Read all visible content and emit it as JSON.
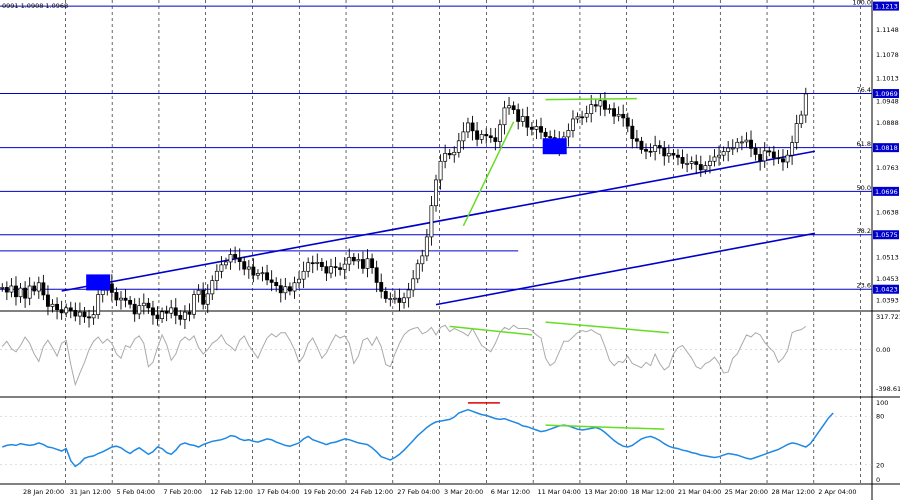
{
  "chart_data": {
    "type": "candlestick",
    "header_text": "0991 1.0908 1.0968",
    "price_axis": {
      "ylim": [
        1.0365,
        1.123
      ],
      "ticks": [
        1.1148,
        1.1078,
        1.1013,
        1.0948,
        1.0888,
        1.0763,
        1.0638,
        1.0513,
        1.0453,
        1.0393
      ],
      "current_price": 1.0969
    },
    "time_labels": [
      "28 Jan 20:00",
      "31 Jan 12:00",
      "5 Feb 04:00",
      "7 Feb 20:00",
      "12 Feb 12:00",
      "17 Feb 04:00",
      "19 Feb 20:00",
      "24 Feb 12:00",
      "27 Feb 04:00",
      "3 Mar 20:00",
      "6 Mar 12:00",
      "11 Mar 04:00",
      "13 Mar 20:00",
      "18 Mar 12:00",
      "21 Mar 04:00",
      "25 Mar 20:00",
      "28 Mar 12:00",
      "2 Apr 04:00"
    ],
    "fib_levels": [
      {
        "label": "100.0",
        "price": 1.1213
      },
      {
        "label": "76.4",
        "price": 1.0969
      },
      {
        "label": "61.8",
        "price": 1.0818
      },
      {
        "label": "50.0",
        "price": 1.0696
      },
      {
        "label": "38.2",
        "price": 1.0575
      },
      {
        "label": "23.6",
        "price": 1.0423
      }
    ],
    "support_line_price": 1.053,
    "trendlines": [
      {
        "name": "upper",
        "start": {
          "bar": 13,
          "price": 1.0418
        },
        "end": {
          "bar": 178,
          "price": 1.0808
        }
      },
      {
        "name": "lower",
        "start": {
          "bar": 95,
          "price": 1.038
        },
        "end": {
          "bar": 178,
          "price": 1.0579
        }
      }
    ],
    "close_series": [
      1.0428,
      1.0415,
      1.0432,
      1.0402,
      1.0426,
      1.0398,
      1.0432,
      1.0418,
      1.0441,
      1.0407,
      1.0375,
      1.0381,
      1.0366,
      1.0357,
      1.0371,
      1.0364,
      1.0348,
      1.0359,
      1.0346,
      1.0343,
      1.0352,
      1.0408,
      1.042,
      1.0438,
      1.0414,
      1.0393,
      1.0398,
      1.0392,
      1.0381,
      1.0354,
      1.0377,
      1.0384,
      1.0371,
      1.0351,
      1.0341,
      1.036,
      1.0356,
      1.0371,
      1.035,
      1.0339,
      1.0359,
      1.0353,
      1.0408,
      1.042,
      1.0381,
      1.041,
      1.0447,
      1.0473,
      1.0491,
      1.0499,
      1.052,
      1.051,
      1.05,
      1.0479,
      1.0485,
      1.0462,
      1.0467,
      1.0469,
      1.0449,
      1.0442,
      1.0433,
      1.0413,
      1.043,
      1.0418,
      1.0441,
      1.0451,
      1.0473,
      1.0497,
      1.0495,
      1.0498,
      1.0486,
      1.0468,
      1.0486,
      1.0483,
      1.0478,
      1.0493,
      1.0512,
      1.0502,
      1.0506,
      1.0481,
      1.0508,
      1.0483,
      1.0442,
      1.0417,
      1.0397,
      1.0397,
      1.0398,
      1.0386,
      1.0399,
      1.0421,
      1.0452,
      1.0494,
      1.0516,
      1.0569,
      1.0656,
      1.0728,
      1.078,
      1.0802,
      1.0798,
      1.0805,
      1.0837,
      1.0862,
      1.0887,
      1.0865,
      1.0841,
      1.0855,
      1.0851,
      1.0846,
      1.0835,
      1.0882,
      1.0929,
      1.0935,
      1.0924,
      1.0891,
      1.0905,
      1.0875,
      1.0869,
      1.0877,
      1.0861,
      1.0849,
      1.0846,
      1.0819,
      1.0837,
      1.0848,
      1.0866,
      1.0898,
      1.0904,
      1.0903,
      1.0913,
      1.0938,
      1.0934,
      1.0949,
      1.0925,
      1.0927,
      1.0906,
      1.0911,
      1.0901,
      1.0878,
      1.0843,
      1.0836,
      1.0813,
      1.0808,
      1.0807,
      1.0824,
      1.0817,
      1.0795,
      1.0802,
      1.0797,
      1.0791,
      1.0774,
      1.0774,
      1.0779,
      1.0771,
      1.0756,
      1.0768,
      1.078,
      1.0792,
      1.0797,
      1.0807,
      1.0817,
      1.0817,
      1.0833,
      1.0834,
      1.0839,
      1.0816,
      1.0799,
      1.0781,
      1.0809,
      1.0806,
      1.079,
      1.0787,
      1.0778,
      1.0797,
      1.0832,
      1.0885,
      1.0909,
      1.0968
    ],
    "markers": [
      {
        "bar": 21,
        "price": 1.0442
      },
      {
        "bar": 121,
        "price": 1.0822
      }
    ],
    "indicator1": {
      "label_max": "317.7217",
      "label_mid": "0.00",
      "label_min": "-398.612",
      "ylim": [
        -398.612,
        317.7217
      ],
      "values": [
        30,
        80,
        10,
        -20,
        40,
        120,
        60,
        -40,
        -110,
        30,
        90,
        20,
        -60,
        60,
        90,
        -140,
        -330,
        -220,
        -120,
        0,
        80,
        120,
        60,
        100,
        60,
        -40,
        -80,
        40,
        20,
        100,
        130,
        60,
        -160,
        -120,
        20,
        140,
        50,
        -100,
        -40,
        80,
        120,
        90,
        130,
        20,
        -40,
        0,
        60,
        90,
        140,
        60,
        30,
        -10,
        90,
        130,
        40,
        -20,
        -80,
        20,
        110,
        150,
        120,
        160,
        160,
        90,
        0,
        -120,
        -60,
        60,
        110,
        20,
        -80,
        -30,
        60,
        140,
        110,
        130,
        60,
        -130,
        -60,
        90,
        110,
        40,
        120,
        30,
        -140,
        -160,
        -40,
        60,
        140,
        180,
        200,
        210,
        150,
        170,
        210,
        140,
        210,
        230,
        170,
        200,
        180,
        160,
        130,
        200,
        120,
        40,
        10,
        -20,
        60,
        160,
        210,
        190,
        230,
        200,
        200,
        200,
        180,
        140,
        110,
        -80,
        -150,
        -120,
        -20,
        80,
        80,
        120,
        160,
        180,
        170,
        190,
        160,
        140,
        30,
        -100,
        -150,
        -110,
        -120,
        -60,
        -130,
        -150,
        -170,
        -120,
        -150,
        -40,
        -130,
        -190,
        -160,
        -40,
        20,
        40,
        -20,
        -80,
        -160,
        -180,
        -130,
        -110,
        -70,
        -130,
        -220,
        -210,
        -80,
        -40,
        50,
        140,
        120,
        160,
        140,
        70,
        20,
        -20,
        -120,
        -80,
        -10,
        160,
        180,
        190,
        220
      ]
    },
    "indicator2": {
      "label_max": "100",
      "label_80": "80",
      "label_20": "20",
      "label_0": "0",
      "ylim": [
        0,
        100
      ],
      "values": [
        42,
        44,
        45,
        44,
        46,
        45,
        44,
        45,
        47,
        45,
        42,
        41,
        39,
        37,
        40,
        25,
        18,
        22,
        28,
        30,
        31,
        34,
        36,
        39,
        42,
        43,
        41,
        37,
        34,
        38,
        41,
        37,
        33,
        36,
        42,
        40,
        35,
        33,
        38,
        45,
        47,
        45,
        44,
        42,
        45,
        47,
        49,
        50,
        51,
        53,
        56,
        55,
        52,
        50,
        51,
        49,
        48,
        50,
        52,
        51,
        48,
        46,
        44,
        43,
        45,
        47,
        52,
        55,
        51,
        49,
        47,
        45,
        47,
        48,
        50,
        52,
        51,
        49,
        47,
        46,
        45,
        41,
        36,
        30,
        28,
        26,
        29,
        33,
        38,
        44,
        50,
        56,
        61,
        66,
        70,
        73,
        74,
        75,
        76,
        79,
        84,
        86,
        88,
        86,
        84,
        82,
        81,
        79,
        77,
        76,
        77,
        75,
        73,
        71,
        68,
        67,
        65,
        63,
        61,
        62,
        64,
        66,
        68,
        69,
        68,
        66,
        64,
        63,
        64,
        65,
        66,
        64,
        60,
        55,
        50,
        46,
        43,
        42,
        44,
        48,
        52,
        54,
        55,
        53,
        50,
        46,
        43,
        41,
        40,
        38,
        37,
        35,
        34,
        32,
        31,
        30,
        29,
        30,
        32,
        34,
        33,
        32,
        30,
        28,
        27,
        29,
        31,
        33,
        35,
        37,
        39,
        42,
        45,
        47,
        46,
        44,
        42,
        46,
        54,
        62,
        70,
        78,
        84
      ]
    },
    "ind1_divergences": [
      {
        "x": [
          98,
          116
        ],
        "y": [
          220,
          140
        ]
      },
      {
        "x": [
          119,
          146
        ],
        "y": [
          260,
          160
        ]
      }
    ],
    "ind2_divergence": {
      "x": [
        119,
        145
      ],
      "y": [
        69,
        64
      ]
    },
    "ind2_topmark": {
      "x": [
        102,
        109
      ],
      "y": [
        96.5,
        96.5
      ]
    },
    "price_divergence": {
      "x": [
        119,
        139
      ],
      "y": [
        1.0952,
        1.0955
      ]
    },
    "price_rally": {
      "x": [
        101,
        112
      ],
      "y": [
        1.06,
        1.089
      ]
    },
    "colors": {
      "candle": "#000000",
      "fib": "#0000cc",
      "marker": "#0000ff",
      "divergence": "#66dd22",
      "divergence_red": "#dd0000",
      "indicator1": "#aaaaaa",
      "indicator2": "#1e88e5",
      "grid": "#000000",
      "tag_bg": "#0000cc"
    }
  }
}
